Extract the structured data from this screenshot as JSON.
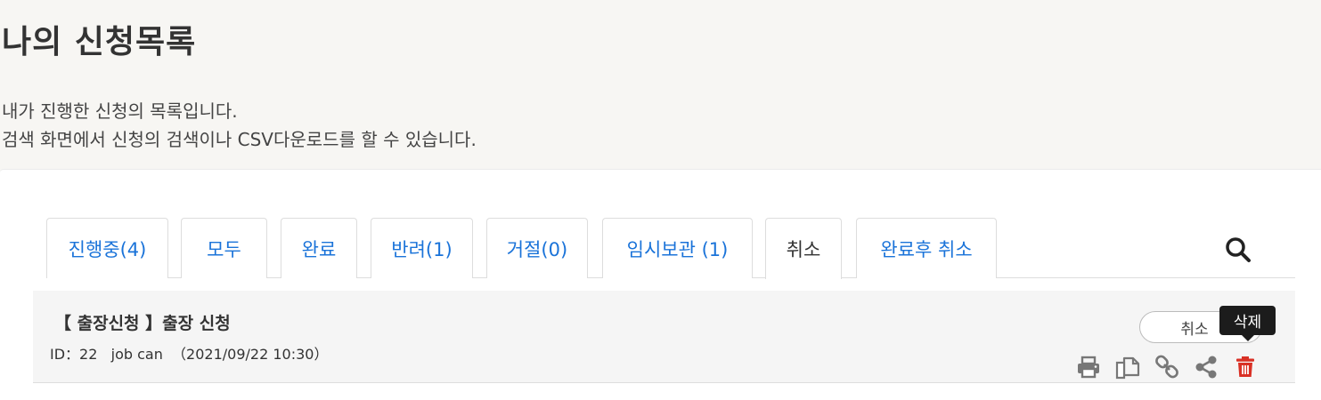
{
  "page": {
    "title": "나의 신청목록",
    "description_line1": "내가 진행한 신청의 목록입니다.",
    "description_line2": "검색 화면에서 신청의 검색이나 CSV다운로드를 할 수 있습니다."
  },
  "tabs": [
    {
      "label": "진행중(4)"
    },
    {
      "label": "모두"
    },
    {
      "label": "완료"
    },
    {
      "label": "반려(1)"
    },
    {
      "label": "거절(0)"
    },
    {
      "label": "임시보관 (1)"
    },
    {
      "label": "취소",
      "active": true
    },
    {
      "label": "완료후 취소"
    }
  ],
  "icons": {
    "search": "search-icon",
    "print": "print-icon",
    "copy": "copy-icon",
    "link": "link-icon",
    "share": "share-icon",
    "delete": "trash-icon"
  },
  "list": {
    "items": [
      {
        "title": "【 출장신청 】출장 신청",
        "meta": "ID：22   job can  （2021/09/22 10:30）",
        "status_button": "취소",
        "tooltip": "삭제"
      }
    ]
  },
  "colors": {
    "tab_link": "#1a73d9",
    "delete_icon": "#d93025",
    "action_icon": "#777777",
    "background": "#f7f6f3"
  }
}
